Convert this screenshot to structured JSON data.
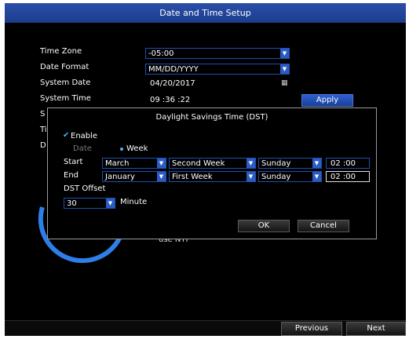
{
  "window": {
    "title": "Date and Time Setup"
  },
  "settings": {
    "time_zone_label": "Time Zone",
    "time_zone_value": "-05:00",
    "date_format_label": "Date Format",
    "date_format_value": "MM/DD/YYYY",
    "system_date_label": "System Date",
    "system_date_value": "04/20/2017",
    "system_time_label": "System Time",
    "system_time_value": "09 :36 :22",
    "apply_label": "Apply",
    "partial_labels": [
      "S",
      "Ti",
      "D"
    ],
    "background_text": "use NTP"
  },
  "dst_dialog": {
    "title": "Daylight Savings Time (DST)",
    "enable_label": "Enable",
    "enable_checked": true,
    "mode_date_label": "Date",
    "mode_week_label": "Week",
    "mode_selected": "Week",
    "start": {
      "label": "Start",
      "month": "March",
      "week": "Second Week",
      "day": "Sunday",
      "time": "02 :00"
    },
    "end": {
      "label": "End",
      "month": "January",
      "week": "First Week",
      "day": "Sunday",
      "time": "02 :00"
    },
    "offset_label": "DST Offset",
    "offset_value": "30",
    "offset_unit": "Minute",
    "ok_label": "OK",
    "cancel_label": "Cancel"
  },
  "footer": {
    "previous_label": "Previous",
    "next_label": "Next"
  },
  "colors": {
    "title_bar": "#1c3d8c",
    "field_border": "#1e4fb0",
    "dropdown_arrow_bg": "#2b5cc4",
    "accent": "#3fb6ff"
  }
}
